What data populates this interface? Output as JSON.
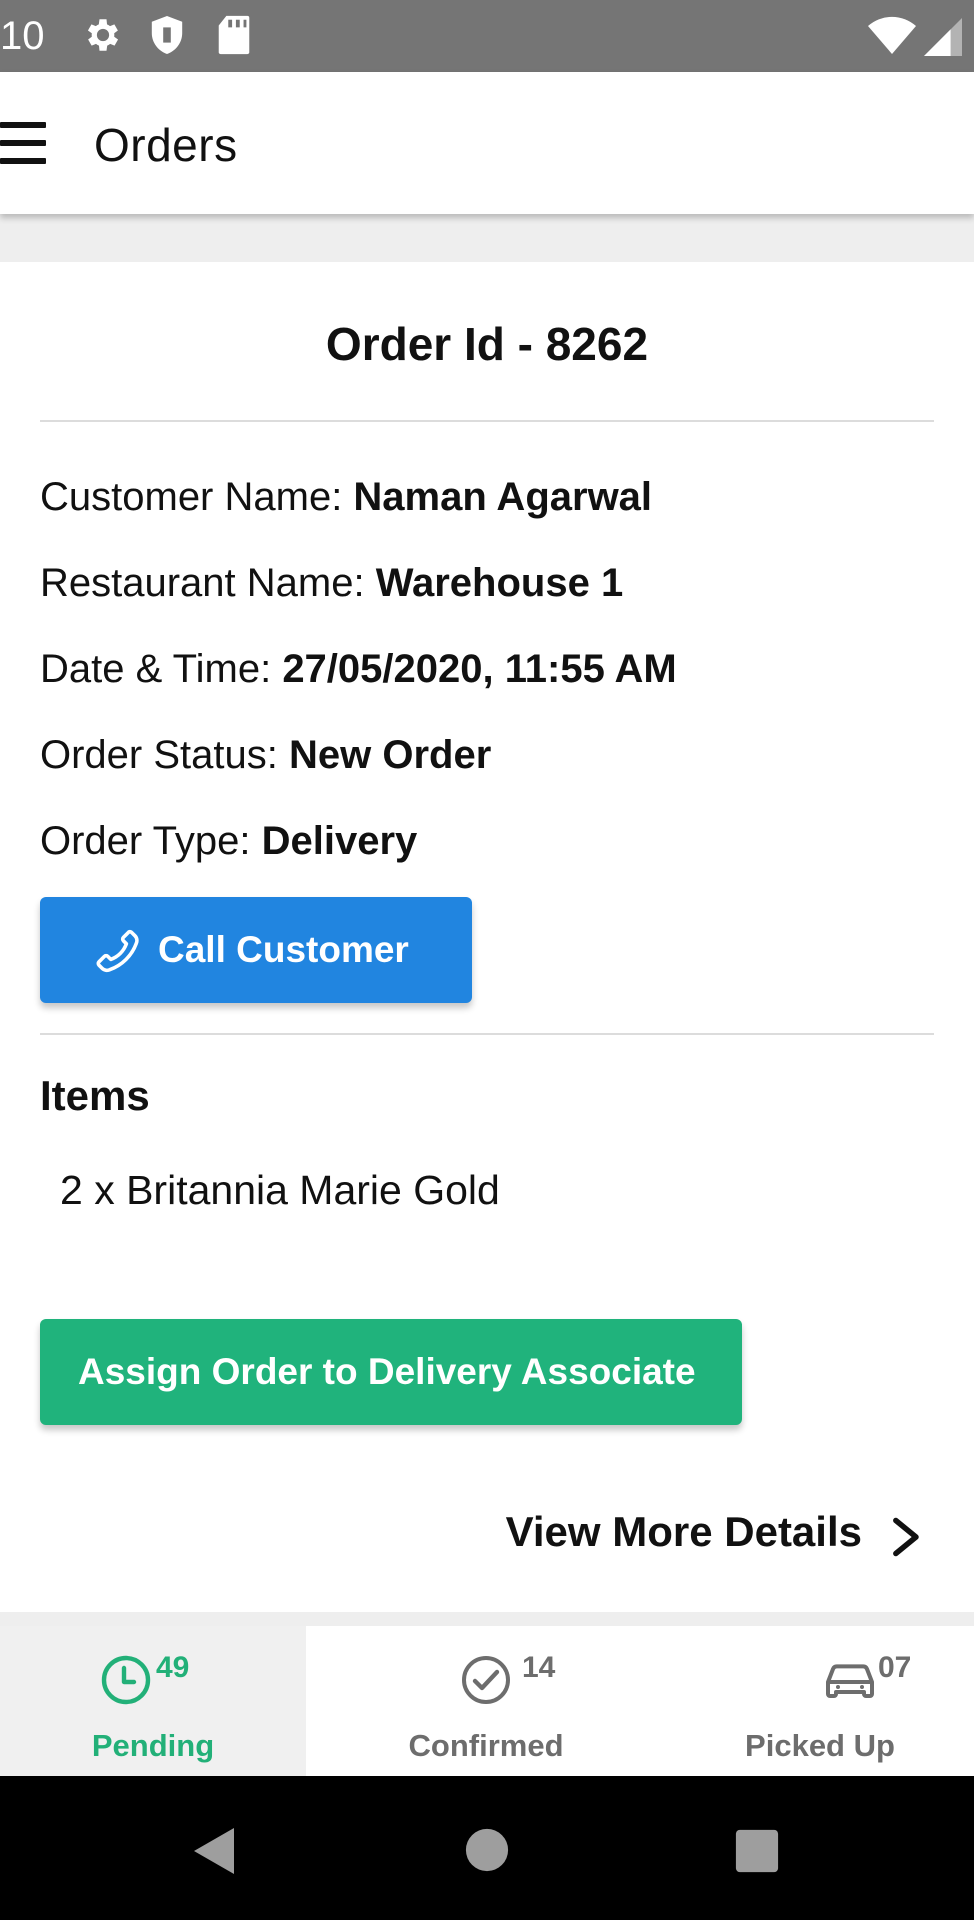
{
  "status_bar": {
    "time": "10",
    "icons": [
      "settings-icon",
      "shield-icon",
      "sd-card-icon",
      "wifi-icon",
      "signal-icon"
    ]
  },
  "app_bar": {
    "title": "Orders",
    "menu_icon": "hamburger-menu-icon"
  },
  "order": {
    "title": "Order Id - 8262",
    "fields": [
      {
        "label": "Customer Name: ",
        "value": "Naman Agarwal"
      },
      {
        "label": "Restaurant Name: ",
        "value": "Warehouse 1"
      },
      {
        "label": "Date & Time: ",
        "value": "27/05/2020, 11:55 AM"
      },
      {
        "label": "Order Status: ",
        "value": "New Order"
      },
      {
        "label": "Order Type: ",
        "value": "Delivery"
      }
    ],
    "call_button_label": "Call Customer",
    "items_heading": "Items",
    "items": [
      "2 x Britannia Marie Gold"
    ],
    "assign_button_label": "Assign Order to Delivery Associate",
    "view_more_label": "View More Details"
  },
  "tabs": [
    {
      "label": "Pending",
      "count": "49",
      "icon": "clock-icon",
      "active": true
    },
    {
      "label": "Confirmed",
      "count": "14",
      "icon": "check-circle-icon",
      "active": false
    },
    {
      "label": "Picked Up",
      "count": "07",
      "icon": "car-icon",
      "active": false
    }
  ],
  "colors": {
    "call_button": "#2185e0",
    "assign_button": "#20b37c",
    "active_tab": "#22b078",
    "inactive_tab": "#6d6d6d"
  }
}
